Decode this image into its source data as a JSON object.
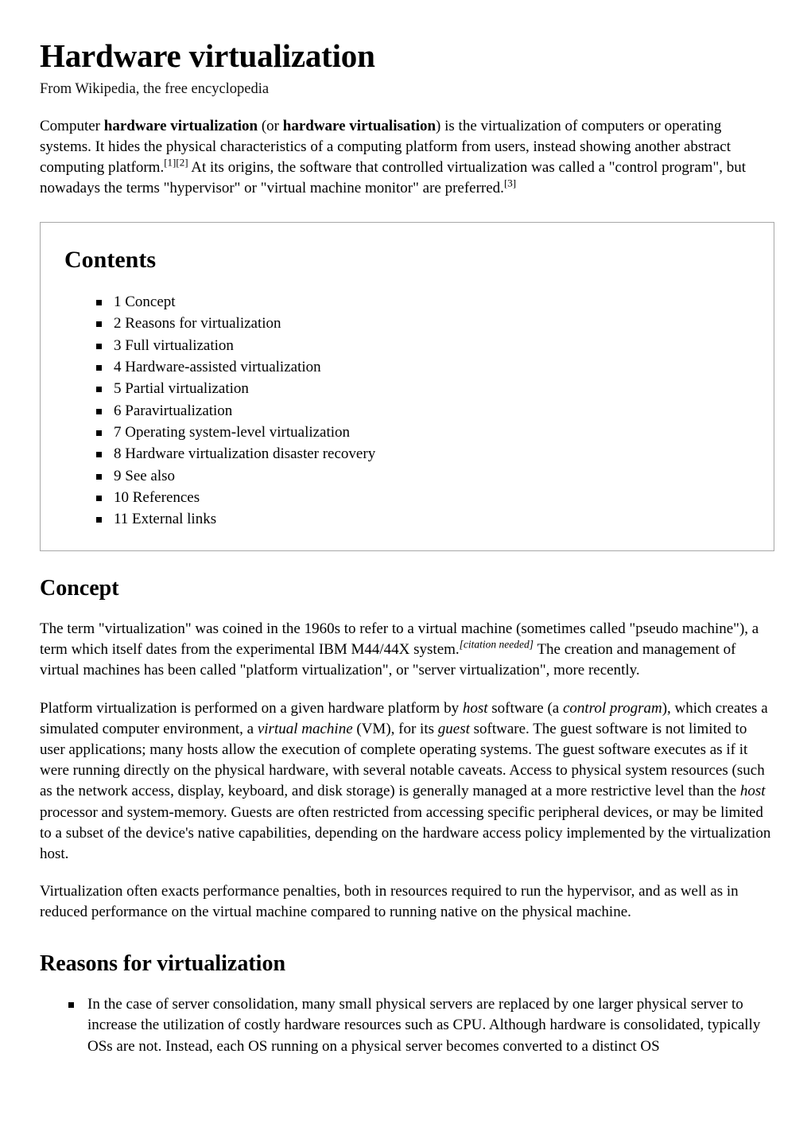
{
  "article": {
    "title": "Hardware virtualization",
    "tagline": "From Wikipedia, the free encyclopedia",
    "intro": {
      "lead_1": "Computer ",
      "bold_1": "hardware virtualization",
      "lead_2": " (or ",
      "bold_2": "hardware virtualisation",
      "lead_3": ") is the virtualization of computers or operating systems. It hides the physical characteristics of a computing platform from users, instead showing another abstract computing platform.",
      "ref_1": "[1]",
      "ref_2": "[2]",
      "lead_4": " At its origins, the software that controlled virtualization was called a \"control program\", but nowadays the terms \"hypervisor\" or \"virtual machine monitor\" are preferred.",
      "ref_3": "[3]"
    }
  },
  "toc": {
    "heading": "Contents",
    "items": [
      {
        "label": "1 Concept"
      },
      {
        "label": "2 Reasons for virtualization"
      },
      {
        "label": "3 Full virtualization"
      },
      {
        "label": "4 Hardware-assisted virtualization"
      },
      {
        "label": "5 Partial virtualization"
      },
      {
        "label": "6 Paravirtualization"
      },
      {
        "label": "7 Operating system-level virtualization"
      },
      {
        "label": "8 Hardware virtualization disaster recovery"
      },
      {
        "label": "9 See also"
      },
      {
        "label": "10 References"
      },
      {
        "label": "11 External links"
      }
    ]
  },
  "sections": {
    "concept": {
      "heading": "Concept",
      "para_1": {
        "t1": "The term \"virtualization\" was coined in the 1960s to refer to a virtual machine (sometimes called \"pseudo machine\"), a term which itself dates from the experimental IBM M44/44X system.",
        "citation_needed": "[citation needed]",
        "t2": " The creation and management of virtual machines has been called \"platform virtualization\", or \"server virtualization\", more recently."
      },
      "para_2": {
        "t1": "Platform virtualization is performed on a given hardware platform by ",
        "i1": "host",
        "t2": " software (a ",
        "i2": "control program",
        "t3": "), which creates a simulated computer environment, a ",
        "i3": "virtual machine",
        "t4": " (VM), for its ",
        "i4": "guest",
        "t5": " software. The guest software is not limited to user applications; many hosts allow the execution of complete operating systems. The guest software executes as if it were running directly on the physical hardware, with several notable caveats. Access to physical system resources (such as the network access, display, keyboard, and disk storage) is generally managed at a more restrictive level than the ",
        "i5": "host",
        "t6": " processor and system-memory. Guests are often restricted from accessing specific peripheral devices, or may be limited to a subset of the device's native capabilities, depending on the hardware access policy implemented by the virtualization host."
      },
      "para_3": "Virtualization often exacts performance penalties, both in resources required to run the hypervisor, and as well as in reduced performance on the virtual machine compared to running native on the physical machine."
    },
    "reasons": {
      "heading": "Reasons for virtualization",
      "bullets": [
        {
          "text": "In the case of server consolidation, many small physical servers are replaced by one larger physical server to increase the utilization of costly hardware resources such as CPU. Although hardware is consolidated, typically OSs are not. Instead, each OS running on a physical server becomes converted to a distinct OS"
        }
      ]
    }
  }
}
